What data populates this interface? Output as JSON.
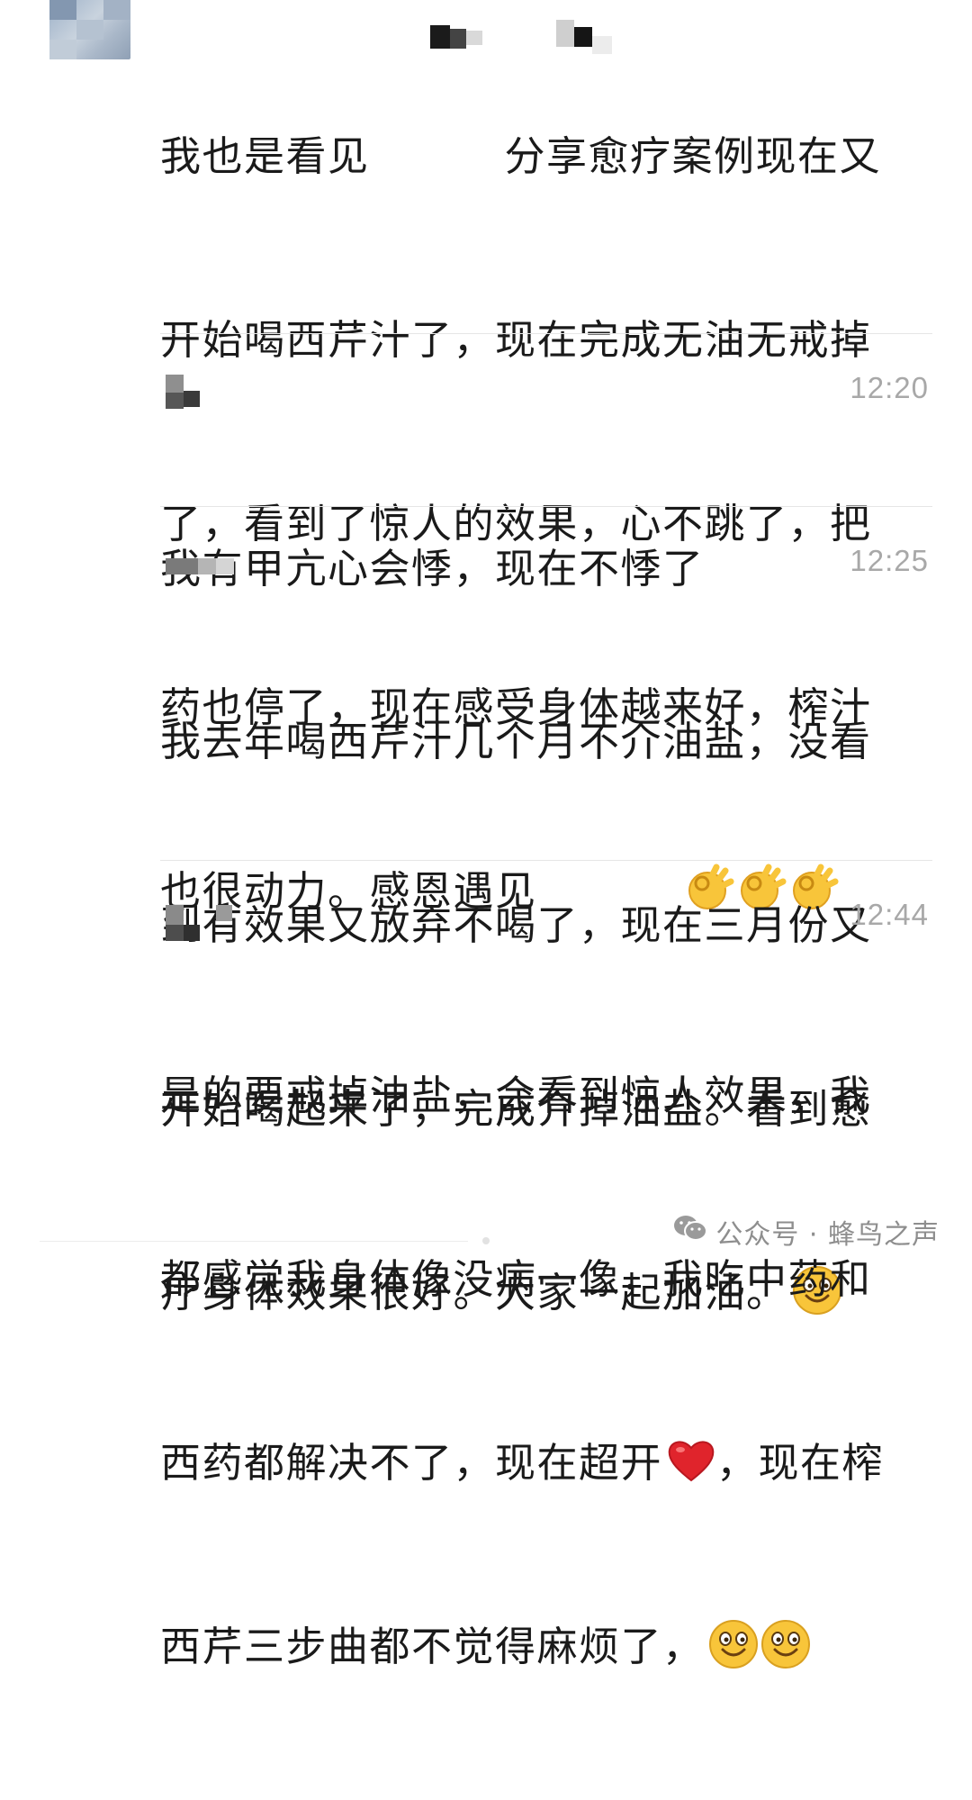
{
  "comments": [
    {
      "time": "",
      "lines": [
        "我也是看见",
        "分享愈疗案例现在又",
        "开始喝西芹汁了，现在完成无油无戒掉",
        "了，看到了惊人的效果，心不跳了，把",
        "药也停了，现在感受身体越来好，榨汁",
        "也很动力。感恩遇见"
      ],
      "emoji": "ok-hand"
    },
    {
      "time": "12:20",
      "lines": [
        "我有甲亢心会悸，现在不悸了"
      ]
    },
    {
      "time": "12:25",
      "lines": [
        "我去年喝西芹汁几个月不介油盐，没看",
        "到有效果又放弃不喝了，现在三月份又",
        "开始喝起来了，完成介掉油盐。看到愈",
        "疗身体效果很好。大家一起加油。"
      ],
      "emoji": "smile"
    },
    {
      "time": "12:44",
      "lines": [
        "是的要戒掉油盐，会看到惊人效果，我",
        "都感觉我身体像没病一像，我吃中药和",
        "西药都解决不了，现在超开",
        "，现在榨",
        "西芹三步曲都不觉得麻烦了，"
      ],
      "emoji": "heart"
    }
  ],
  "footer": {
    "brand": "公众号 · 蜂鸟之声",
    "brand_icon": "wechat-icon"
  },
  "colors": {
    "timestamp": "#a8a8a8",
    "divider": "#e6e6e6",
    "emoji_yellow": "#f8c53a",
    "heart_red": "#e0242c"
  }
}
